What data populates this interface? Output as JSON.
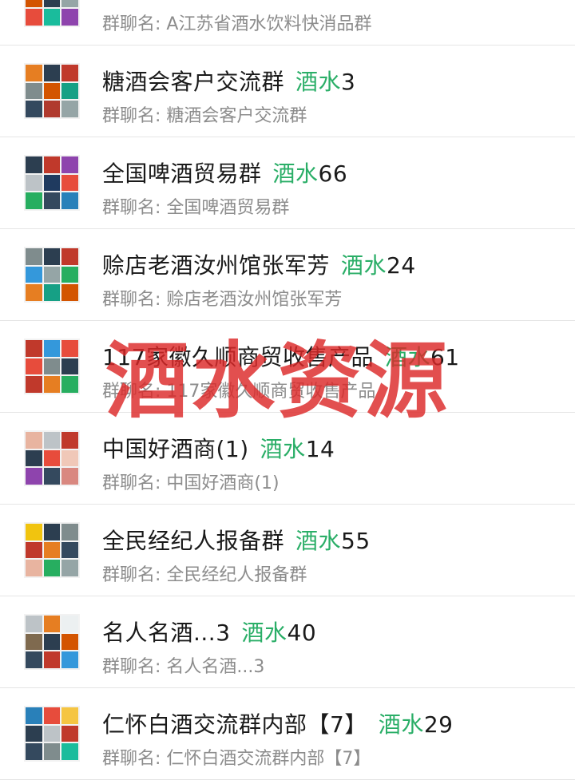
{
  "groups": [
    {
      "name": "",
      "tag": "",
      "num": "",
      "sub": "群聊名: A江苏省酒水饮料快消品群",
      "colors": [
        "#c0392b",
        "#34495e",
        "#7f8c8d",
        "#d35400",
        "#2c3e50",
        "#95a5a6",
        "#e74c3c",
        "#1abc9c",
        "#8e44ad"
      ]
    },
    {
      "name": "糖酒会客户交流群",
      "tag": "酒水",
      "num": "3",
      "sub": "群聊名: 糖酒会客户交流群",
      "colors": [
        "#e67e22",
        "#2c3e50",
        "#c0392b",
        "#7f8c8d",
        "#d35400",
        "#16a085",
        "#34495e",
        "#b03a2e",
        "#95a5a6"
      ]
    },
    {
      "name": "全国啤酒贸易群",
      "tag": "酒水",
      "num": "66",
      "sub": "群聊名: 全国啤酒贸易群",
      "colors": [
        "#2c3e50",
        "#c0392b",
        "#8e44ad",
        "#bdc3c7",
        "#1f3a5f",
        "#e74c3c",
        "#27ae60",
        "#34495e",
        "#2980b9"
      ]
    },
    {
      "name": "赊店老酒汝州馆张军芳",
      "tag": "酒水",
      "num": "24",
      "sub": "群聊名: 赊店老酒汝州馆张军芳",
      "colors": [
        "#7f8c8d",
        "#2c3e50",
        "#c0392b",
        "#3498db",
        "#95a5a6",
        "#27ae60",
        "#e67e22",
        "#16a085",
        "#d35400"
      ]
    },
    {
      "name": "117家徽久顺商贸收售产品",
      "tag": "酒水",
      "num": "61",
      "sub": "群聊名: 117家徽久顺商贸收售产品",
      "colors": [
        "#c0392b",
        "#3498db",
        "#e74c3c",
        "#e74c3c",
        "#7f8c8d",
        "#2c3e50",
        "#c0392b",
        "#e67e22",
        "#27ae60"
      ]
    },
    {
      "name": "中国好酒商(1)",
      "tag": "酒水",
      "num": "14",
      "sub": "群聊名: 中国好酒商(1)",
      "colors": [
        "#e8b4a0",
        "#bdc3c7",
        "#c0392b",
        "#2c3e50",
        "#e74c3c",
        "#f0c8b8",
        "#8e44ad",
        "#34495e",
        "#d98880"
      ]
    },
    {
      "name": "全民经纪人报备群",
      "tag": "酒水",
      "num": "55",
      "sub": "群聊名: 全民经纪人报备群",
      "colors": [
        "#f1c40f",
        "#2c3e50",
        "#7f8c8d",
        "#c0392b",
        "#e67e22",
        "#34495e",
        "#e8b4a0",
        "#27ae60",
        "#95a5a6"
      ]
    },
    {
      "name": "名人名酒...3",
      "tag": "酒水",
      "num": "40",
      "sub": "群聊名: 名人名酒...3",
      "colors": [
        "#bdc3c7",
        "#e67e22",
        "#ecf0f1",
        "#7f6a4f",
        "#2c3e50",
        "#d35400",
        "#34495e",
        "#c0392b",
        "#3498db"
      ]
    },
    {
      "name": "仁怀白酒交流群内部【7】",
      "tag": "酒水",
      "num": "29",
      "sub": "群聊名: 仁怀白酒交流群内部【7】",
      "colors": [
        "#2980b9",
        "#e74c3c",
        "#f5c542",
        "#2c3e50",
        "#bdc3c7",
        "#c0392b",
        "#34495e",
        "#7f8c8d",
        "#1abc9c"
      ]
    }
  ],
  "overlay_text": "酒水资源"
}
